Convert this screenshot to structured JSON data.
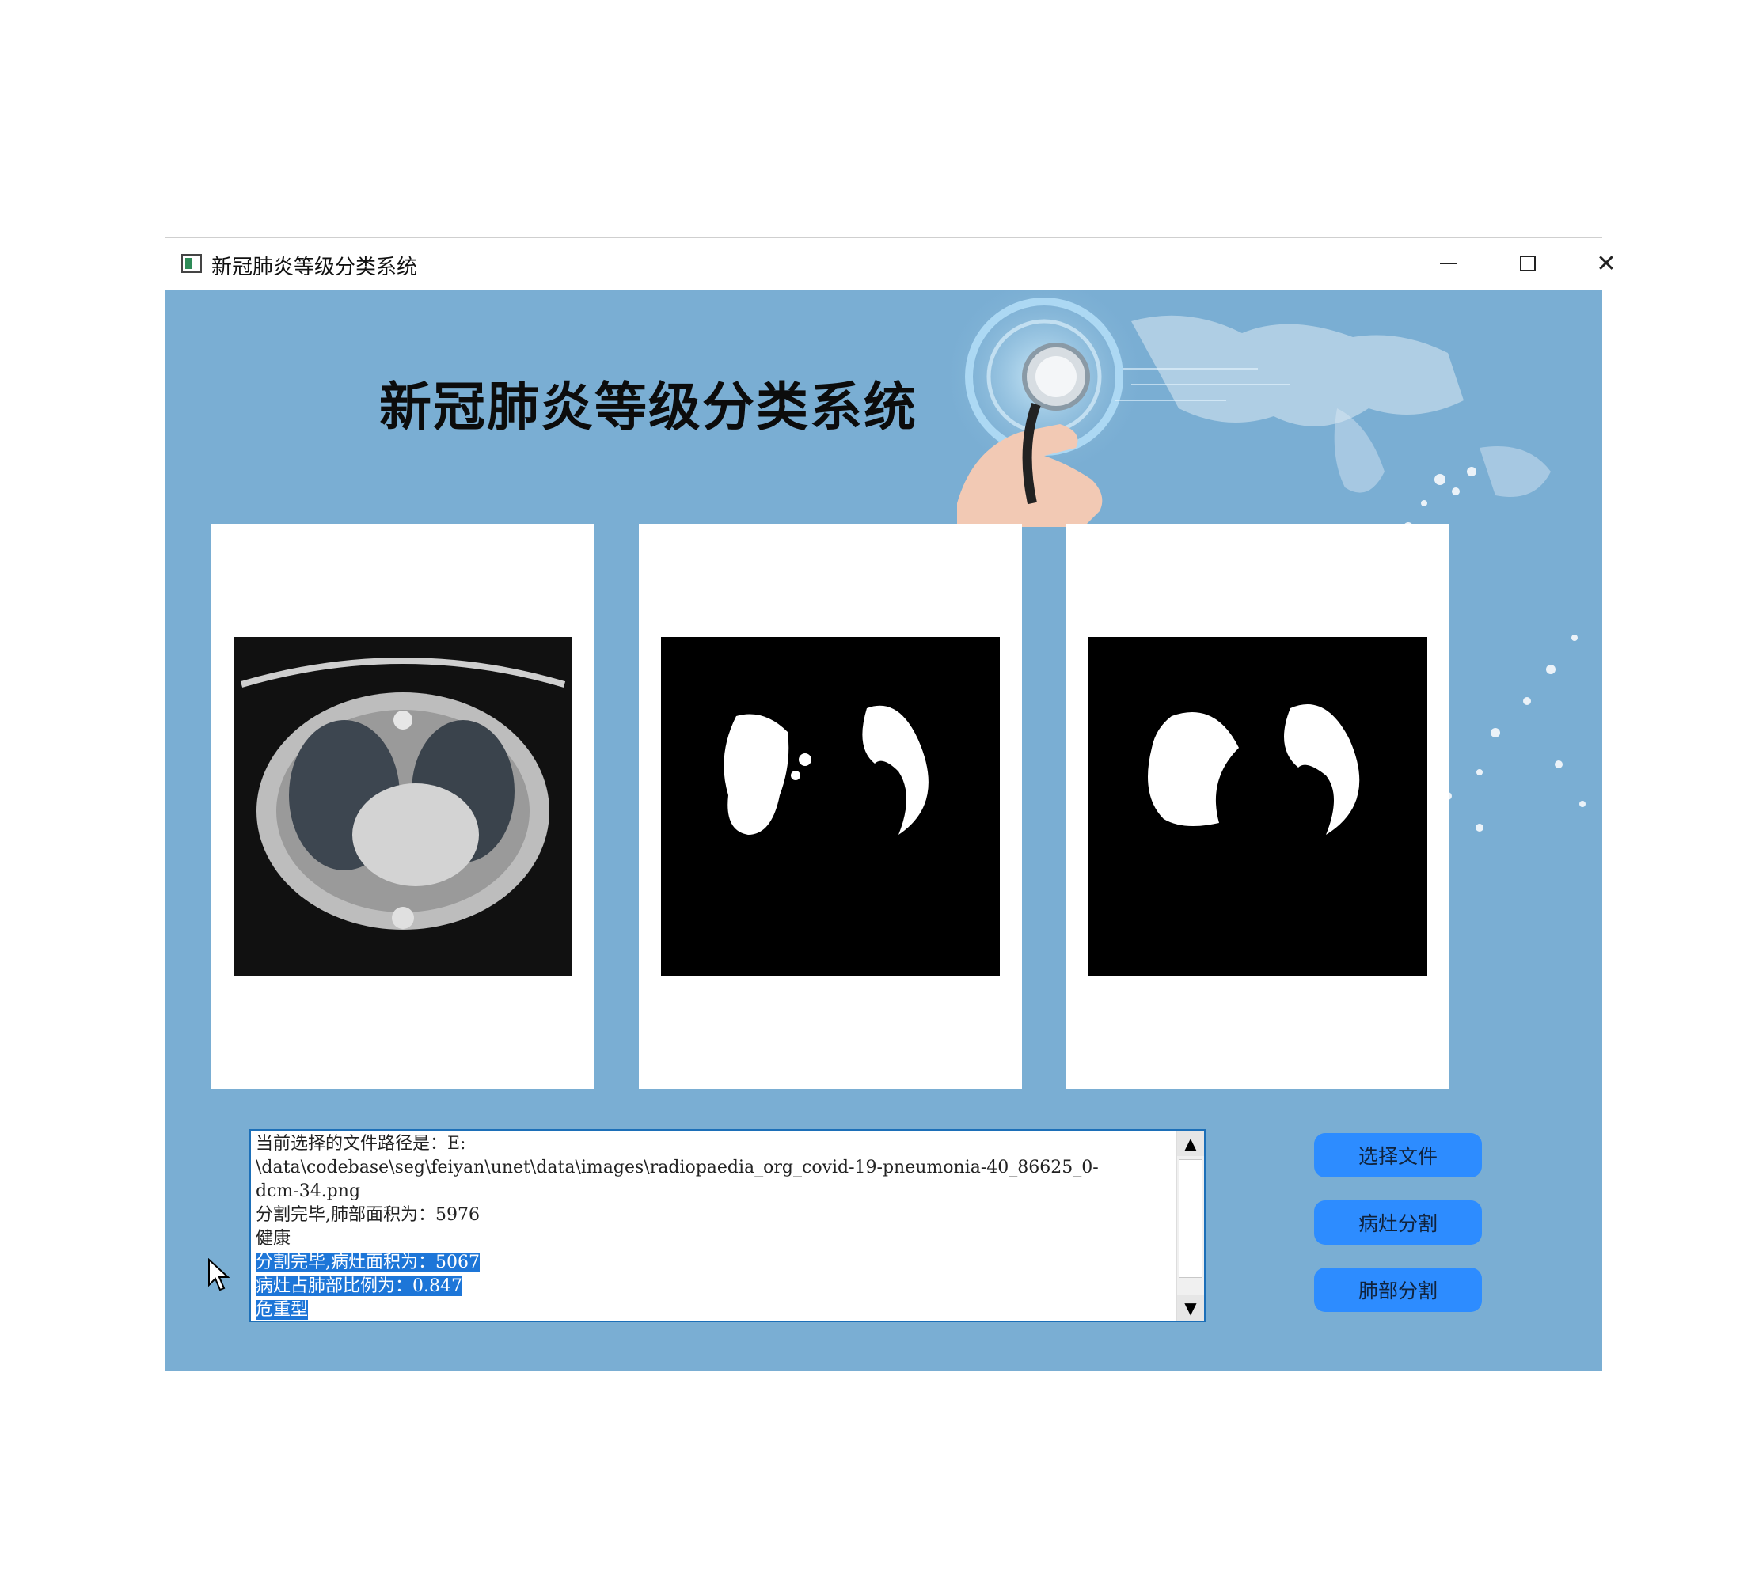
{
  "window": {
    "title": "新冠肺炎等级分类系统"
  },
  "header": {
    "title": "新冠肺炎等级分类系统"
  },
  "panels": [
    {
      "name": "original-ct-image"
    },
    {
      "name": "lesion-mask-image"
    },
    {
      "name": "lung-mask-image"
    }
  ],
  "log": {
    "lines": [
      "当前选择的文件路径是：E:",
      "\\data\\codebase\\seg\\feiyan\\unet\\data\\images\\radiopaedia_org_covid-19-pneumonia-40_86625_0-",
      "dcm-34.png",
      "分割完毕,肺部面积为：5976",
      "健康",
      "分割完毕,病灶面积为：5067",
      "病灶占肺部比例为：0.847",
      "危重型"
    ],
    "selected_from": 5
  },
  "buttons": {
    "select_file": "选择文件",
    "lesion_segment": "病灶分割",
    "lung_segment": "肺部分割"
  },
  "colors": {
    "background": "#7aaed3",
    "button": "#2d8cff",
    "selection": "#1d76d8"
  }
}
